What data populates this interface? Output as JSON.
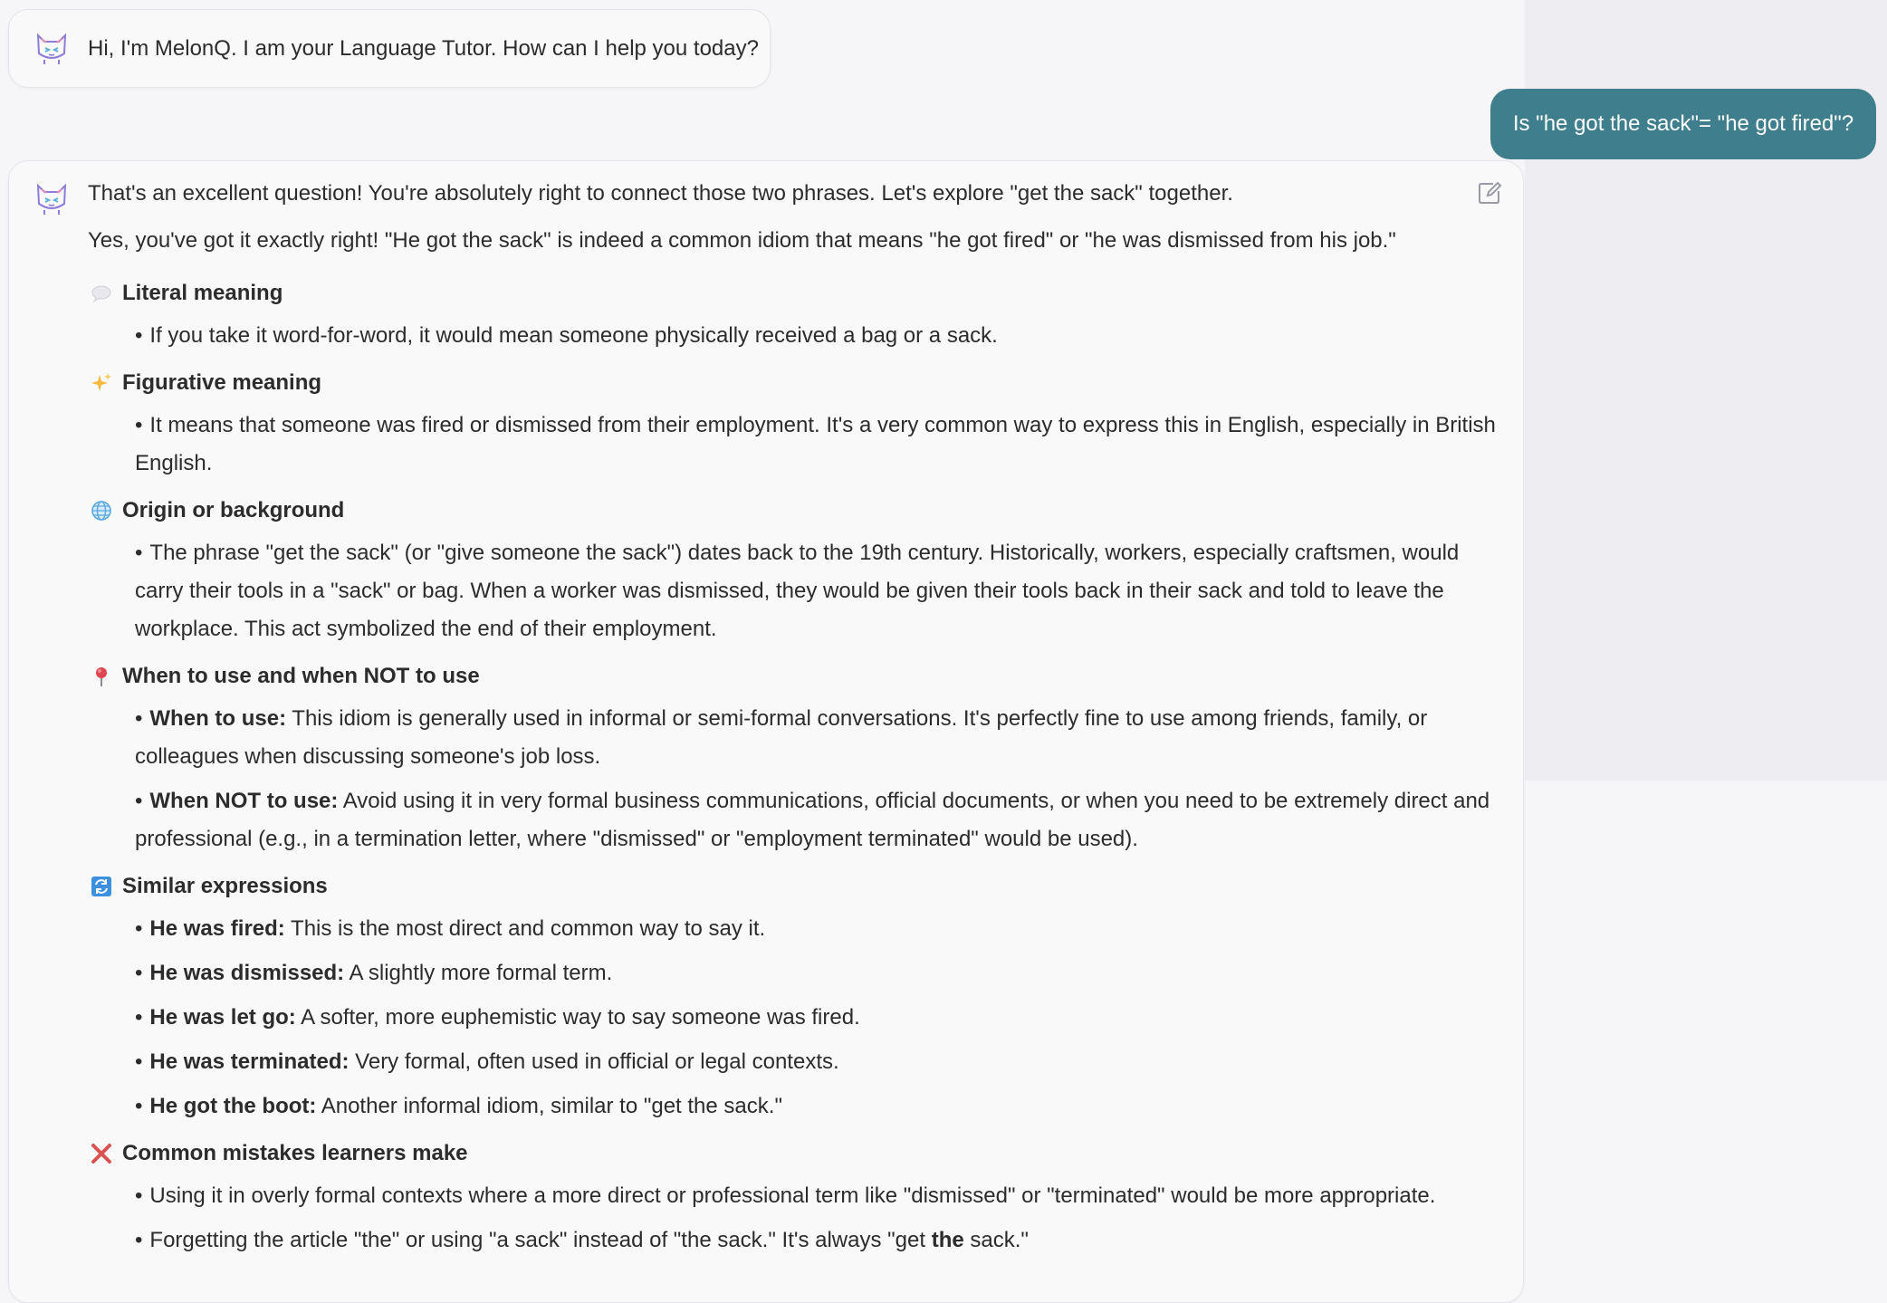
{
  "greeting": {
    "text": "Hi, I'm MelonQ. I am your Language Tutor. How can I help you today?",
    "avatar_icon": "cat-face-icon"
  },
  "user_message": {
    "text": "Is \"he got the sack\"= \"he got fired\"?"
  },
  "answer": {
    "intro": "That's an excellent question! You're absolutely right to connect those two phrases. Let's explore \"get the sack\" together.",
    "confirm": "Yes, you've got it exactly right! \"He got the sack\" is indeed a common idiom that means \"he got fired\" or \"he was dismissed from his job.\"",
    "sections": {
      "literal": {
        "icon": "speech-bubble-icon",
        "title": "Literal meaning",
        "b1": "If you take it word-for-word, it would mean someone physically received a bag or a sack."
      },
      "figurative": {
        "icon": "sparkles-icon",
        "title": "Figurative meaning",
        "b1": "It means that someone was fired or dismissed from their employment. It's a very common way to express this in English, especially in British English."
      },
      "origin": {
        "icon": "globe-icon",
        "title": "Origin or background",
        "b1": "The phrase \"get the sack\" (or \"give someone the sack\") dates back to the 19th century. Historically, workers, especially craftsmen, would carry their tools in a \"sack\" or bag. When a worker was dismissed, they would be given their tools back in their sack and told to leave the workplace. This act symbolized the end of their employment."
      },
      "usage": {
        "icon": "pushpin-icon",
        "title": "When to use and when NOT to use",
        "b1_label": "When to use:",
        "b1_text": "This idiom is generally used in informal or semi-formal conversations. It's perfectly fine to use among friends, family, or colleagues when discussing someone's job loss.",
        "b2_label": "When NOT to use:",
        "b2_text": "Avoid using it in very formal business communications, official documents, or when you need to be extremely direct and professional (e.g., in a termination letter, where \"dismissed\" or \"employment terminated\" would be used)."
      },
      "similar": {
        "icon": "repeat-icon",
        "title": "Similar expressions",
        "b1_label": "He was fired:",
        "b1_text": "This is the most direct and common way to say it.",
        "b2_label": "He was dismissed:",
        "b2_text": "A slightly more formal term.",
        "b3_label": "He was let go:",
        "b3_text": "A softer, more euphemistic way to say someone was fired.",
        "b4_label": "He was terminated:",
        "b4_text": "Very formal, often used in official or legal contexts.",
        "b5_label": "He got the boot:",
        "b5_text": "Another informal idiom, similar to \"get the sack.\""
      },
      "mistakes": {
        "icon": "cross-mark-icon",
        "title": "Common mistakes learners make",
        "b1": "Using it in overly formal contexts where a more direct or professional term like \"dismissed\" or \"terminated\" would be more appropriate.",
        "b2_pre": "Forgetting the article \"the\" or using \"a sack\" instead of \"the sack.\" It's always \"get ",
        "b2_bold": "the",
        "b2_post": " sack.\""
      }
    },
    "edit_icon": "edit-icon"
  },
  "colors": {
    "user_bubble": "#3f7e8c",
    "background": "#f6f6f8",
    "mistake_red": "#d9534f"
  }
}
